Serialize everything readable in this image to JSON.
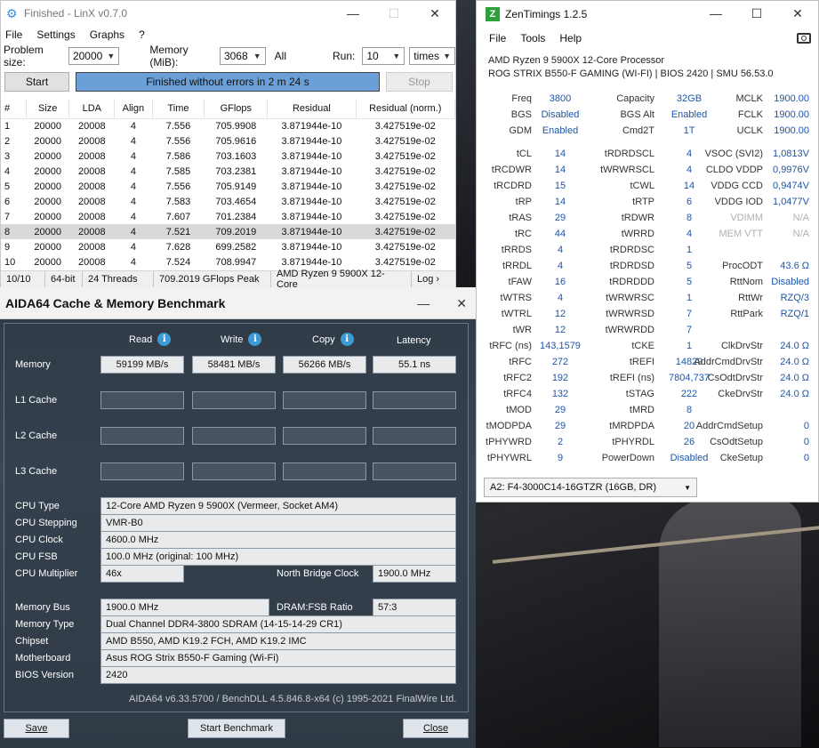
{
  "linx": {
    "title": "Finished - LinX v0.7.0",
    "menu": [
      "File",
      "Settings",
      "Graphs",
      "?"
    ],
    "problem_size_label": "Problem size:",
    "problem_size": "20000",
    "memory_label": "Memory (MiB):",
    "memory": "3068",
    "all_label": "All",
    "run_label": "Run:",
    "run": "10",
    "times": "times",
    "start": "Start",
    "status": "Finished without errors in 2 m 24 s",
    "stop": "Stop",
    "columns": [
      "#",
      "Size",
      "LDA",
      "Align",
      "Time",
      "GFlops",
      "Residual",
      "Residual (norm.)"
    ],
    "rows": [
      [
        "1",
        "20000",
        "20008",
        "4",
        "7.556",
        "705.9908",
        "3.871944e-10",
        "3.427519e-02"
      ],
      [
        "2",
        "20000",
        "20008",
        "4",
        "7.556",
        "705.9616",
        "3.871944e-10",
        "3.427519e-02"
      ],
      [
        "3",
        "20000",
        "20008",
        "4",
        "7.586",
        "703.1603",
        "3.871944e-10",
        "3.427519e-02"
      ],
      [
        "4",
        "20000",
        "20008",
        "4",
        "7.585",
        "703.2381",
        "3.871944e-10",
        "3.427519e-02"
      ],
      [
        "5",
        "20000",
        "20008",
        "4",
        "7.556",
        "705.9149",
        "3.871944e-10",
        "3.427519e-02"
      ],
      [
        "6",
        "20000",
        "20008",
        "4",
        "7.583",
        "703.4654",
        "3.871944e-10",
        "3.427519e-02"
      ],
      [
        "7",
        "20000",
        "20008",
        "4",
        "7.607",
        "701.2384",
        "3.871944e-10",
        "3.427519e-02"
      ],
      [
        "8",
        "20000",
        "20008",
        "4",
        "7.521",
        "709.2019",
        "3.871944e-10",
        "3.427519e-02"
      ],
      [
        "9",
        "20000",
        "20008",
        "4",
        "7.628",
        "699.2582",
        "3.871944e-10",
        "3.427519e-02"
      ],
      [
        "10",
        "20000",
        "20008",
        "4",
        "7.524",
        "708.9947",
        "3.871944e-10",
        "3.427519e-02"
      ]
    ],
    "selected_row": 8,
    "statusbar": {
      "progress": "10/10",
      "arch": "64-bit",
      "threads": "24 Threads",
      "peak": "709.2019 GFlops Peak",
      "cpu": "AMD Ryzen 9 5900X 12-Core",
      "log": "Log ›"
    }
  },
  "zen": {
    "title": "ZenTimings 1.2.5",
    "logo": "Z",
    "menu": [
      "File",
      "Tools",
      "Help"
    ],
    "cpu": "AMD Ryzen 9 5900X 12-Core Processor",
    "board": "ROG STRIX B550-F GAMING (WI-FI) | BIOS 2420 | SMU 56.53.0",
    "top": [
      [
        "Freq",
        "3800",
        "Capacity",
        "32GB",
        "MCLK",
        "1900.00"
      ],
      [
        "BGS",
        "Disabled",
        "BGS Alt",
        "Enabled",
        "FCLK",
        "1900.00"
      ],
      [
        "GDM",
        "Enabled",
        "Cmd2T",
        "1T",
        "UCLK",
        "1900.00"
      ]
    ],
    "timings": [
      [
        "tCL",
        "14",
        "tRDRDSCL",
        "4",
        "VSOC (SVI2)",
        "1,0813V"
      ],
      [
        "tRCDWR",
        "14",
        "tWRWRSCL",
        "4",
        "CLDO VDDP",
        "0,9976V"
      ],
      [
        "tRCDRD",
        "15",
        "tCWL",
        "14",
        "VDDG CCD",
        "0,9474V"
      ],
      [
        "tRP",
        "14",
        "tRTP",
        "6",
        "VDDG IOD",
        "1,0477V"
      ],
      [
        "tRAS",
        "29",
        "tRDWR",
        "8",
        "VDIMM",
        "N/A"
      ],
      [
        "tRC",
        "44",
        "tWRRD",
        "4",
        "MEM VTT",
        "N/A"
      ],
      [
        "tRRDS",
        "4",
        "tRDRDSC",
        "1",
        "",
        ""
      ],
      [
        "tRRDL",
        "4",
        "tRDRDSD",
        "5",
        "ProcODT",
        "43.6 Ω"
      ],
      [
        "tFAW",
        "16",
        "tRDRDDD",
        "5",
        "RttNom",
        "Disabled"
      ],
      [
        "tWTRS",
        "4",
        "tWRWRSC",
        "1",
        "RttWr",
        "RZQ/3"
      ],
      [
        "tWTRL",
        "12",
        "tWRWRSD",
        "7",
        "RttPark",
        "RZQ/1"
      ],
      [
        "tWR",
        "12",
        "tWRWRDD",
        "7",
        "",
        ""
      ],
      [
        "tRFC (ns)",
        "143,1579",
        "tCKE",
        "1",
        "ClkDrvStr",
        "24.0 Ω"
      ],
      [
        "tRFC",
        "272",
        "tREFI",
        "14829",
        "AddrCmdDrvStr",
        "24.0 Ω"
      ],
      [
        "tRFC2",
        "192",
        "tREFI (ns)",
        "7804,737",
        "CsOdtDrvStr",
        "24.0 Ω"
      ],
      [
        "tRFC4",
        "132",
        "tSTAG",
        "222",
        "CkeDrvStr",
        "24.0 Ω"
      ],
      [
        "tMOD",
        "29",
        "tMRD",
        "8",
        "",
        ""
      ],
      [
        "tMODPDA",
        "29",
        "tMRDPDA",
        "20",
        "AddrCmdSetup",
        "0"
      ],
      [
        "tPHYWRD",
        "2",
        "tPHYRDL",
        "26",
        "CsOdtSetup",
        "0"
      ],
      [
        "tPHYWRL",
        "9",
        "PowerDown",
        "Disabled",
        "CkeSetup",
        "0"
      ]
    ],
    "dimm": "A2: F4-3000C14-16GTZR (16GB, DR)"
  },
  "aida": {
    "title": "AIDA64 Cache & Memory Benchmark",
    "headers": [
      "Read",
      "Write",
      "Copy",
      "Latency"
    ],
    "rows": [
      {
        "label": "Memory",
        "values": [
          "59199 MB/s",
          "58481 MB/s",
          "56266 MB/s",
          "55.1 ns"
        ]
      },
      {
        "label": "L1 Cache",
        "values": [
          "",
          "",
          "",
          ""
        ]
      },
      {
        "label": "L2 Cache",
        "values": [
          "",
          "",
          "",
          ""
        ]
      },
      {
        "label": "L3 Cache",
        "values": [
          "",
          "",
          "",
          ""
        ]
      }
    ],
    "cpu_type_label": "CPU Type",
    "cpu_type": "12-Core AMD Ryzen 9 5900X  (Vermeer, Socket AM4)",
    "cpu_stepping_label": "CPU Stepping",
    "cpu_stepping": "VMR-B0",
    "cpu_clock_label": "CPU Clock",
    "cpu_clock": "4600.0 MHz",
    "cpu_fsb_label": "CPU FSB",
    "cpu_fsb": "100.0 MHz  (original: 100 MHz)",
    "cpu_mult_label": "CPU Multiplier",
    "cpu_mult": "46x",
    "nb_clock_label": "North Bridge Clock",
    "nb_clock": "1900.0 MHz",
    "mem_bus_label": "Memory Bus",
    "mem_bus": "1900.0 MHz",
    "ratio_label": "DRAM:FSB Ratio",
    "ratio": "57:3",
    "mem_type_label": "Memory Type",
    "mem_type": "Dual Channel DDR4-3800 SDRAM  (14-15-14-29 CR1)",
    "chipset_label": "Chipset",
    "chipset": "AMD B550, AMD K19.2 FCH, AMD K19.2 IMC",
    "mobo_label": "Motherboard",
    "mobo": "Asus ROG Strix B550-F Gaming (Wi-Fi)",
    "bios_label": "BIOS Version",
    "bios": "2420",
    "footer": "AIDA64 v6.33.5700 / BenchDLL 4.5.846.8-x64  (c) 1995-2021 FinalWire Ltd.",
    "save": "Save",
    "start_bench": "Start Benchmark",
    "close": "Close"
  }
}
